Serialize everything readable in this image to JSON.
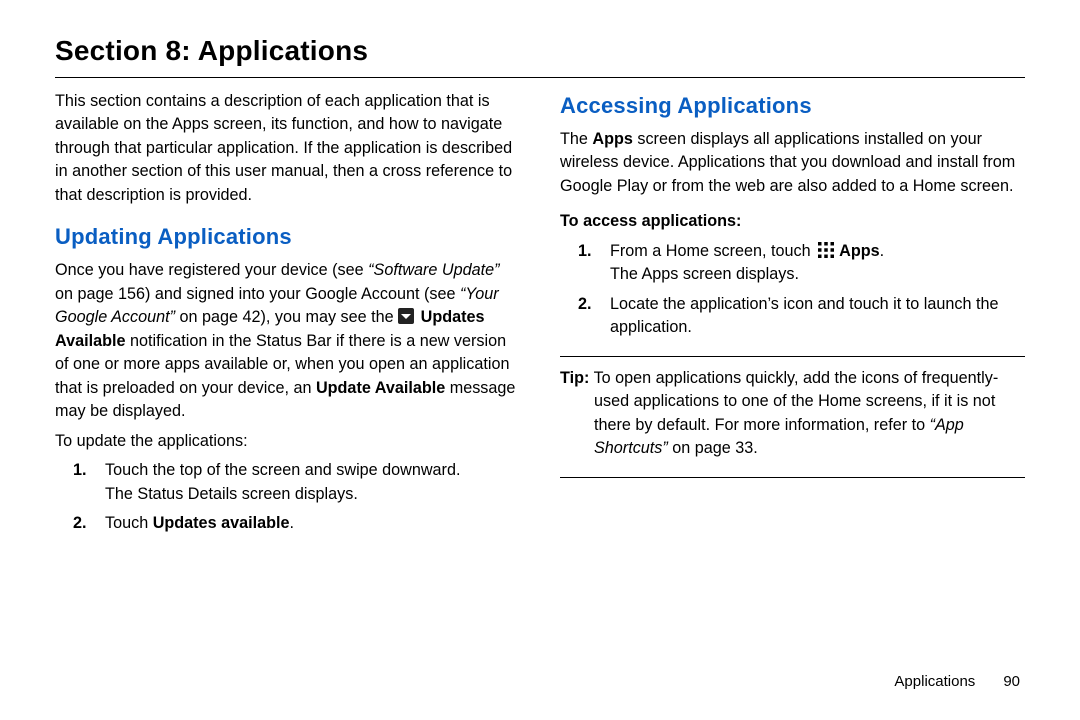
{
  "section_title": "Section 8: Applications",
  "left": {
    "intro": "This section contains a description of each application that is available on the Apps screen, its function, and how to navigate through that particular application. If the application is described in another section of this user manual, then a cross reference to that description is provided.",
    "h_updating": "Updating Applications",
    "updating_p1_a": "Once you have registered your device (see ",
    "updating_p1_ref1": "“Software Update”",
    "updating_p1_b": " on page 156) and signed into your Google Account (see ",
    "updating_p1_ref2": "“Your Google Account”",
    "updating_p1_c": " on page 42), you may see the ",
    "updates_available_strong": "Updates Available",
    "updating_p1_d": " notification in the Status Bar if there is a new version of one or more apps available or, when you open an application that is preloaded on your device, an ",
    "update_available_strong": "Update Available",
    "updating_p1_e": " message may be displayed.",
    "update_lead": "To update the applications:",
    "step1_num": "1.",
    "step1_a": "Touch the top of the screen and swipe downward.",
    "step1_b": "The Status Details screen displays.",
    "step2_num": "2.",
    "step2_a": "Touch ",
    "step2_strong": "Updates available",
    "step2_b": "."
  },
  "right": {
    "h_accessing": "Accessing Applications",
    "access_p1_a": "The ",
    "apps_strong": "Apps",
    "access_p1_b": " screen displays all applications installed on your wireless device. Applications that you download and install from Google Play or from the web are also added to a Home screen.",
    "access_lead": "To access applications:",
    "step1_num": "1.",
    "step1_a": "From a Home screen, touch ",
    "step1_strong": "Apps",
    "step1_b": ".",
    "step1_c": "The Apps screen displays.",
    "step2_num": "2.",
    "step2_a": "Locate the application’s icon and touch it to launch the application.",
    "tip_label": "Tip:",
    "tip_a": " To open applications quickly, add the icons of frequently-used applications to one of the Home screens, if it is not there by default. For more information, refer to ",
    "tip_ref": "“App Shortcuts”",
    "tip_b": " on page 33."
  },
  "footer": {
    "label": "Applications",
    "page": "90"
  }
}
